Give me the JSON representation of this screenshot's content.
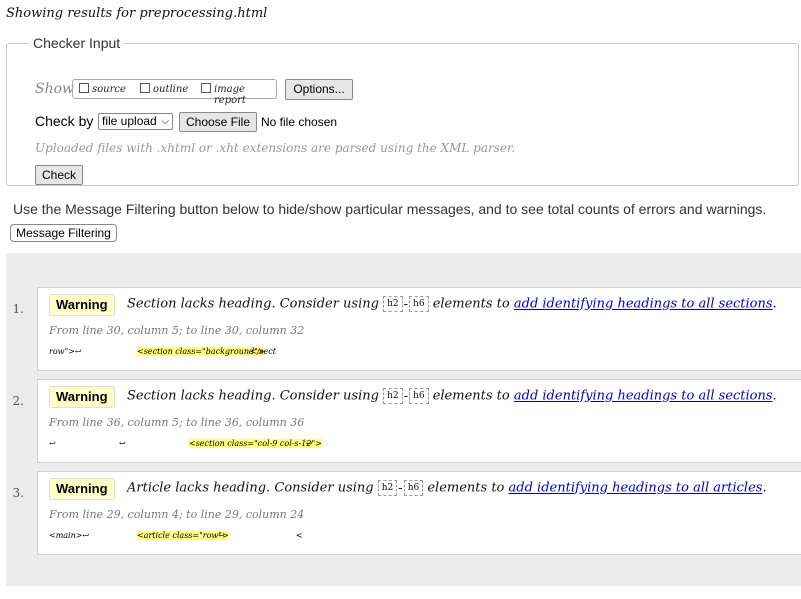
{
  "heading": "Showing results for preprocessing.html",
  "checker": {
    "legend": "Checker Input",
    "show_label": "Show",
    "checkboxes": [
      {
        "label": "source",
        "checked": false
      },
      {
        "label": "outline",
        "checked": false
      },
      {
        "label": "image report",
        "checked": false
      }
    ],
    "options_button": "Options...",
    "checkby_label": "Check by",
    "checkby_value": "file upload",
    "choose_file_button": "Choose File",
    "no_file_text": "No file chosen",
    "uploaded_note": "Uploaded files with .xhtml or .xht extensions are parsed using the XML parser.",
    "check_button": "Check"
  },
  "filter": {
    "note": "Use the Message Filtering button below to hide/show particular messages, and to see total counts of errors and warnings.",
    "button": "Message Filtering"
  },
  "messages": [
    {
      "num": "1.",
      "type": "Warning",
      "text_pre": "Section lacks heading. Consider using",
      "code_start": "h2",
      "dash": "-",
      "code_end": "h6",
      "text_mid": "elements to",
      "link": "add identifying headings to all sections",
      "text_end": ".",
      "location": "From line 30, column 5; to line 30, column 32",
      "extract_before": "row\">↩",
      "extract_highlight": "<section class=\"background\">",
      "extract_after": "</sect"
    },
    {
      "num": "2.",
      "type": "Warning",
      "text_pre": "Section lacks heading. Consider using",
      "code_start": "h2",
      "dash": "-",
      "code_end": "h6",
      "text_mid": "elements to",
      "link": "add identifying headings to all sections",
      "text_end": ".",
      "location": "From line 36, column 5; to line 36, column 36",
      "extract_before": "↩",
      "extract_before2": "↩",
      "extract_highlight": "<section class=\"col-9 col-s-12\">",
      "extract_after": "↩"
    },
    {
      "num": "3.",
      "type": "Warning",
      "text_pre": "Article lacks heading. Consider using",
      "code_start": "h2",
      "dash": "-",
      "code_end": "h6",
      "text_mid": "elements to",
      "link": "add identifying headings to all articles",
      "text_end": ".",
      "location": "From line 29, column 4; to line 29, column 24",
      "extract_before": "<main>↩",
      "extract_highlight": "<article class=\"row\">",
      "extract_after": "↩",
      "extract_trail": "<"
    }
  ]
}
